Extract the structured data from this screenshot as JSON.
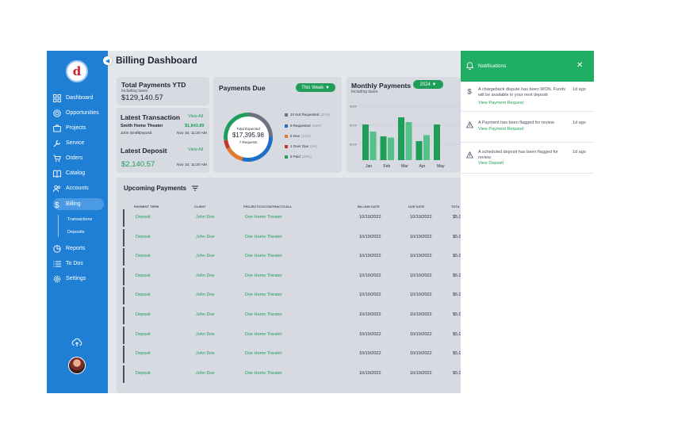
{
  "app": {
    "logo_letter": "d",
    "page_title": "Billing Dashboard"
  },
  "sidebar": {
    "items": [
      {
        "label": "Dashboard",
        "icon": "grid-icon"
      },
      {
        "label": "Opportunities",
        "icon": "target-icon"
      },
      {
        "label": "Projects",
        "icon": "briefcase-icon"
      },
      {
        "label": "Service",
        "icon": "wrench-icon"
      },
      {
        "label": "Orders",
        "icon": "cart-icon"
      },
      {
        "label": "Catalog",
        "icon": "book-icon"
      },
      {
        "label": "Accounts",
        "icon": "users-icon"
      },
      {
        "label": "Billing",
        "icon": "dollar-icon"
      },
      {
        "label": "Reports",
        "icon": "pie-icon"
      },
      {
        "label": "To Dos",
        "icon": "list-icon"
      },
      {
        "label": "Settings",
        "icon": "gear-icon"
      }
    ],
    "sub_items": [
      "Transactions",
      "Deposits"
    ],
    "active": "Billing"
  },
  "total_payments": {
    "title": "Total Payments YTD",
    "subtitle": "Including taxes",
    "amount": "$129,140.57"
  },
  "latest_transaction": {
    "title": "Latest Transaction",
    "link": "View All",
    "name": "Smith Home Theater",
    "amount": "$1,843.89",
    "person": "John Smith",
    "type": "Deposit",
    "date": "Nov 10, 11:20 AM"
  },
  "latest_deposit": {
    "title": "Latest Deposit",
    "link": "View All",
    "amount": "$2,140.57",
    "date": "Nov 10, 11:20 AM"
  },
  "payments_due": {
    "title": "Payments Due",
    "filter": "This Week",
    "donut_label": "Total Expected",
    "donut_amount": "$17,395.98",
    "donut_count": "7 Requests",
    "legend": [
      {
        "label": "10 Not Requested",
        "pct": "(21%)",
        "color": "#6b7280",
        "value": 21
      },
      {
        "label": "9 Requested",
        "pct": "(25%)",
        "color": "#1f6fc4",
        "value": 25
      },
      {
        "label": "5 Due",
        "pct": "(11%)",
        "color": "#e07a2e",
        "value": 11
      },
      {
        "label": "1 Over Due",
        "pct": "(5%)",
        "color": "#c0392b",
        "value": 5
      },
      {
        "label": "9 Paid",
        "pct": "(23%)",
        "color": "#1e9e5a",
        "value": 23
      }
    ]
  },
  "monthly_payments": {
    "title": "Monthly Payments",
    "subtitle": "Including taxes",
    "year": "2024"
  },
  "chart_data": {
    "type": "bar",
    "categories": [
      "Jan",
      "Feb",
      "Mar",
      "Apr",
      "May"
    ],
    "series": [
      {
        "values": [
          150,
          100,
          180,
          80,
          150
        ]
      },
      {
        "values": [
          120,
          95,
          160,
          105,
          0
        ]
      }
    ],
    "y_ticks": [
      "$30K",
      "$20K",
      "$10K"
    ],
    "colors": [
      "#1e9e5a",
      "#56c08a"
    ]
  },
  "upcoming": {
    "title": "Upcoming Payments",
    "columns": [
      "PAYMENT TERM",
      "CLIENT",
      "PROJECT/CO/CONTRACT/CALL",
      "BILLING DATE",
      "DUE DATE",
      "TOTA"
    ],
    "rows": [
      {
        "term": "Deposit",
        "client": "John Doe",
        "project": "Doe Home Theater",
        "billing": "10/10/2022",
        "due": "10/10/2022",
        "total": "$5,0"
      },
      {
        "term": "Deposit",
        "client": "John Doe",
        "project": "Doe Home Theater",
        "billing": "10/10/2022",
        "due": "10/10/2022",
        "total": "$5,0"
      },
      {
        "term": "Deposit",
        "client": "John Doe",
        "project": "Doe Home Theater",
        "billing": "10/10/2022",
        "due": "10/10/2022",
        "total": "$5,0"
      },
      {
        "term": "Deposit",
        "client": "John Doe",
        "project": "Doe Home Theater",
        "billing": "10/10/2022",
        "due": "10/10/2022",
        "total": "$5,0"
      },
      {
        "term": "Deposit",
        "client": "John Doe",
        "project": "Doe Home Theater",
        "billing": "10/10/2022",
        "due": "10/10/2022",
        "total": "$5,0"
      },
      {
        "term": "Deposit",
        "client": "John Doe",
        "project": "Doe Home Theater",
        "billing": "10/10/2022",
        "due": "10/10/2022",
        "total": "$5,0"
      },
      {
        "term": "Deposit",
        "client": "John Doe",
        "project": "Doe Home Theater",
        "billing": "10/10/2022",
        "due": "10/10/2022",
        "total": "$5,0"
      },
      {
        "term": "Deposit",
        "client": "John Doe",
        "project": "Doe Home Theater",
        "billing": "10/10/2022",
        "due": "10/10/2022",
        "total": "$5,0"
      },
      {
        "term": "Deposit",
        "client": "John Doe",
        "project": "Doe Home Theater",
        "billing": "10/10/2022",
        "due": "10/10/2022",
        "total": "$5,0"
      }
    ]
  },
  "notifications": {
    "title": "Notifications",
    "close": "✕",
    "items": [
      {
        "icon": "dollar-icon",
        "text": "A chargeback dispute has been WON. Funds will be available in your next deposit",
        "time": "1d ago",
        "link": "View Payment Request"
      },
      {
        "icon": "warning-icon",
        "text": "A Payment has been flagged for review.",
        "time": "1d ago",
        "link": "View Payment Request"
      },
      {
        "icon": "warning-icon",
        "text": "A scheduled deposit has been flagged for review.",
        "time": "1d ago",
        "link": "View Deposit"
      }
    ]
  }
}
